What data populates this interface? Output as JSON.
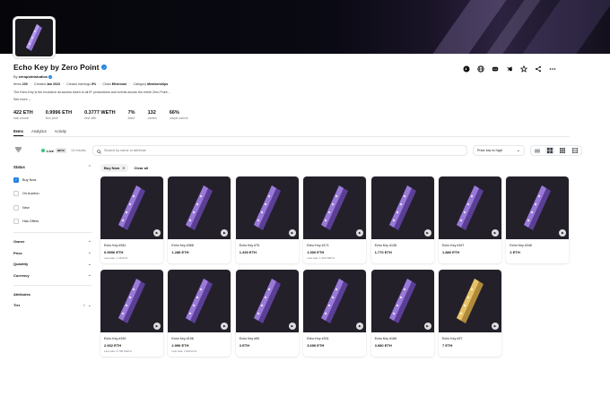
{
  "collection": {
    "title": "Echo Key by Zero Point",
    "by_prefix": "By",
    "creator": "zeropointstudios",
    "meta": [
      {
        "label": "Items",
        "value": "200"
      },
      {
        "label": "Created",
        "value": "Jan 2023"
      },
      {
        "label": "Creator earnings",
        "value": "5%"
      },
      {
        "label": "Chain",
        "value": "Ethereum"
      },
      {
        "label": "Category",
        "value": "Memberships"
      }
    ],
    "description": "The Echo Key is the exclusive all-access token to all IP, productions and events across the entire Zero Point...",
    "see_more": "See more",
    "stats": [
      {
        "value": "422 ETH",
        "label": "total volume"
      },
      {
        "value": "0.9996 ETH",
        "label": "floor price"
      },
      {
        "value": "0.3777 WETH",
        "label": "best offer"
      },
      {
        "value": "7%",
        "label": "listed"
      },
      {
        "value": "132",
        "label": "owners"
      },
      {
        "value": "66%",
        "label": "unique owners"
      }
    ]
  },
  "header_icons": [
    "opensea-icon",
    "globe-icon",
    "discord-icon",
    "twitter-icon",
    "star-icon",
    "share-icon",
    "more-icon"
  ],
  "tabs": [
    {
      "label": "Items",
      "active": true
    },
    {
      "label": "Analytics",
      "active": false
    },
    {
      "label": "Activity",
      "active": false
    }
  ],
  "toolbar": {
    "live_label": "Live",
    "beta_label": "BETA",
    "results": "13 results",
    "search_placeholder": "Search by name or attribute",
    "sort_label": "Price low to high"
  },
  "sidebar": {
    "status_label": "Status",
    "status_options": [
      {
        "label": "Buy Now",
        "checked": true
      },
      {
        "label": "On Auction",
        "checked": false
      },
      {
        "label": "New",
        "checked": false
      },
      {
        "label": "Has Offers",
        "checked": false
      }
    ],
    "filters": [
      "Owner",
      "Price",
      "Quantity",
      "Currency"
    ],
    "attributes_label": "Attributes",
    "tier_label": "Tier",
    "tier_count": "2"
  },
  "chips": {
    "active": "Buy Now",
    "clear": "Clear all"
  },
  "items": [
    {
      "name": "Echo Key #281",
      "price": "0.9996 ETH",
      "last": "Last sale: 1.48 ETH",
      "gold": false
    },
    {
      "name": "Echo Key #368",
      "price": "1.288 ETH",
      "last": "",
      "gold": false
    },
    {
      "name": "Echo Key #75",
      "price": "1.490 ETH",
      "last": "",
      "gold": false
    },
    {
      "name": "Echo Key #171",
      "price": "1.500 ETH",
      "last": "Last sale: 1.332 WETH",
      "gold": false
    },
    {
      "name": "Echo Key #138",
      "price": "1.770 ETH",
      "last": "",
      "gold": false
    },
    {
      "name": "Echo Key #157",
      "price": "1.880 ETH",
      "last": "",
      "gold": false
    },
    {
      "name": "Echo Key #348",
      "price": "2 ETH",
      "last": "",
      "gold": false
    },
    {
      "name": "Echo Key #190",
      "price": "2.932 ETH",
      "last": "Last sale: 0.790 WETH",
      "gold": false
    },
    {
      "name": "Echo Key #196",
      "price": "2.990 ETH",
      "last": "Last sale: 2.500 ETH",
      "gold": false
    },
    {
      "name": "Echo Key #59",
      "price": "3 ETH",
      "last": "",
      "gold": false
    },
    {
      "name": "Echo Key #331",
      "price": "3.690 ETH",
      "last": "",
      "gold": false
    },
    {
      "name": "Echo Key #165",
      "price": "3.980 ETH",
      "last": "",
      "gold": false
    },
    {
      "name": "Echo Key #37",
      "price": "7 ETH",
      "last": "",
      "gold": true
    }
  ]
}
